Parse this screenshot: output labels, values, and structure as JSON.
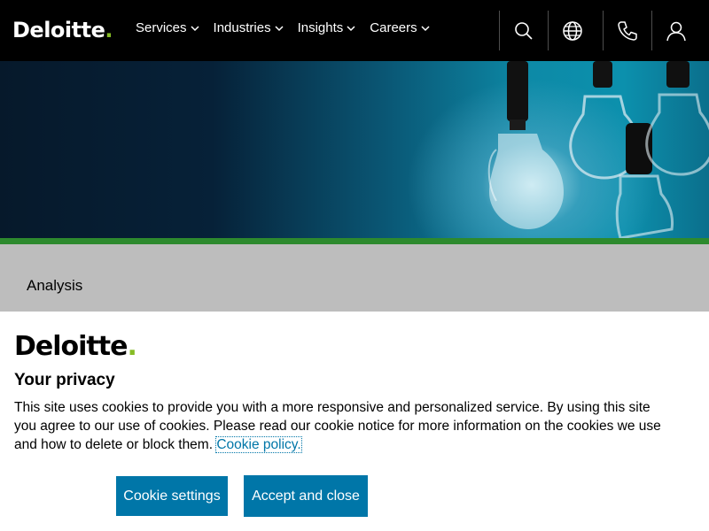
{
  "header": {
    "logo_text": "Deloitte",
    "logo_dot": ".",
    "nav": [
      {
        "label": "Services"
      },
      {
        "label": "Industries"
      },
      {
        "label": "Insights"
      },
      {
        "label": "Careers"
      }
    ],
    "icons": [
      "search-icon",
      "globe-icon",
      "phone-icon",
      "user-icon"
    ]
  },
  "hero": {
    "section_label": "Analysis"
  },
  "cookie_banner": {
    "logo_text": "Deloitte",
    "logo_dot": ".",
    "title": "Your privacy",
    "body": "This site uses cookies to provide you with a more responsive and personalized service. By using this site you agree to our use of cookies. Please read our cookie notice for more information on the cookies we use and how to delete or block them.",
    "link_label": "Cookie policy.",
    "settings_button": "Cookie settings",
    "accept_button": "Accept and close"
  },
  "colors": {
    "brand_green": "#86bc25",
    "accent_blue": "#0076a8",
    "header_bg": "#000000"
  }
}
